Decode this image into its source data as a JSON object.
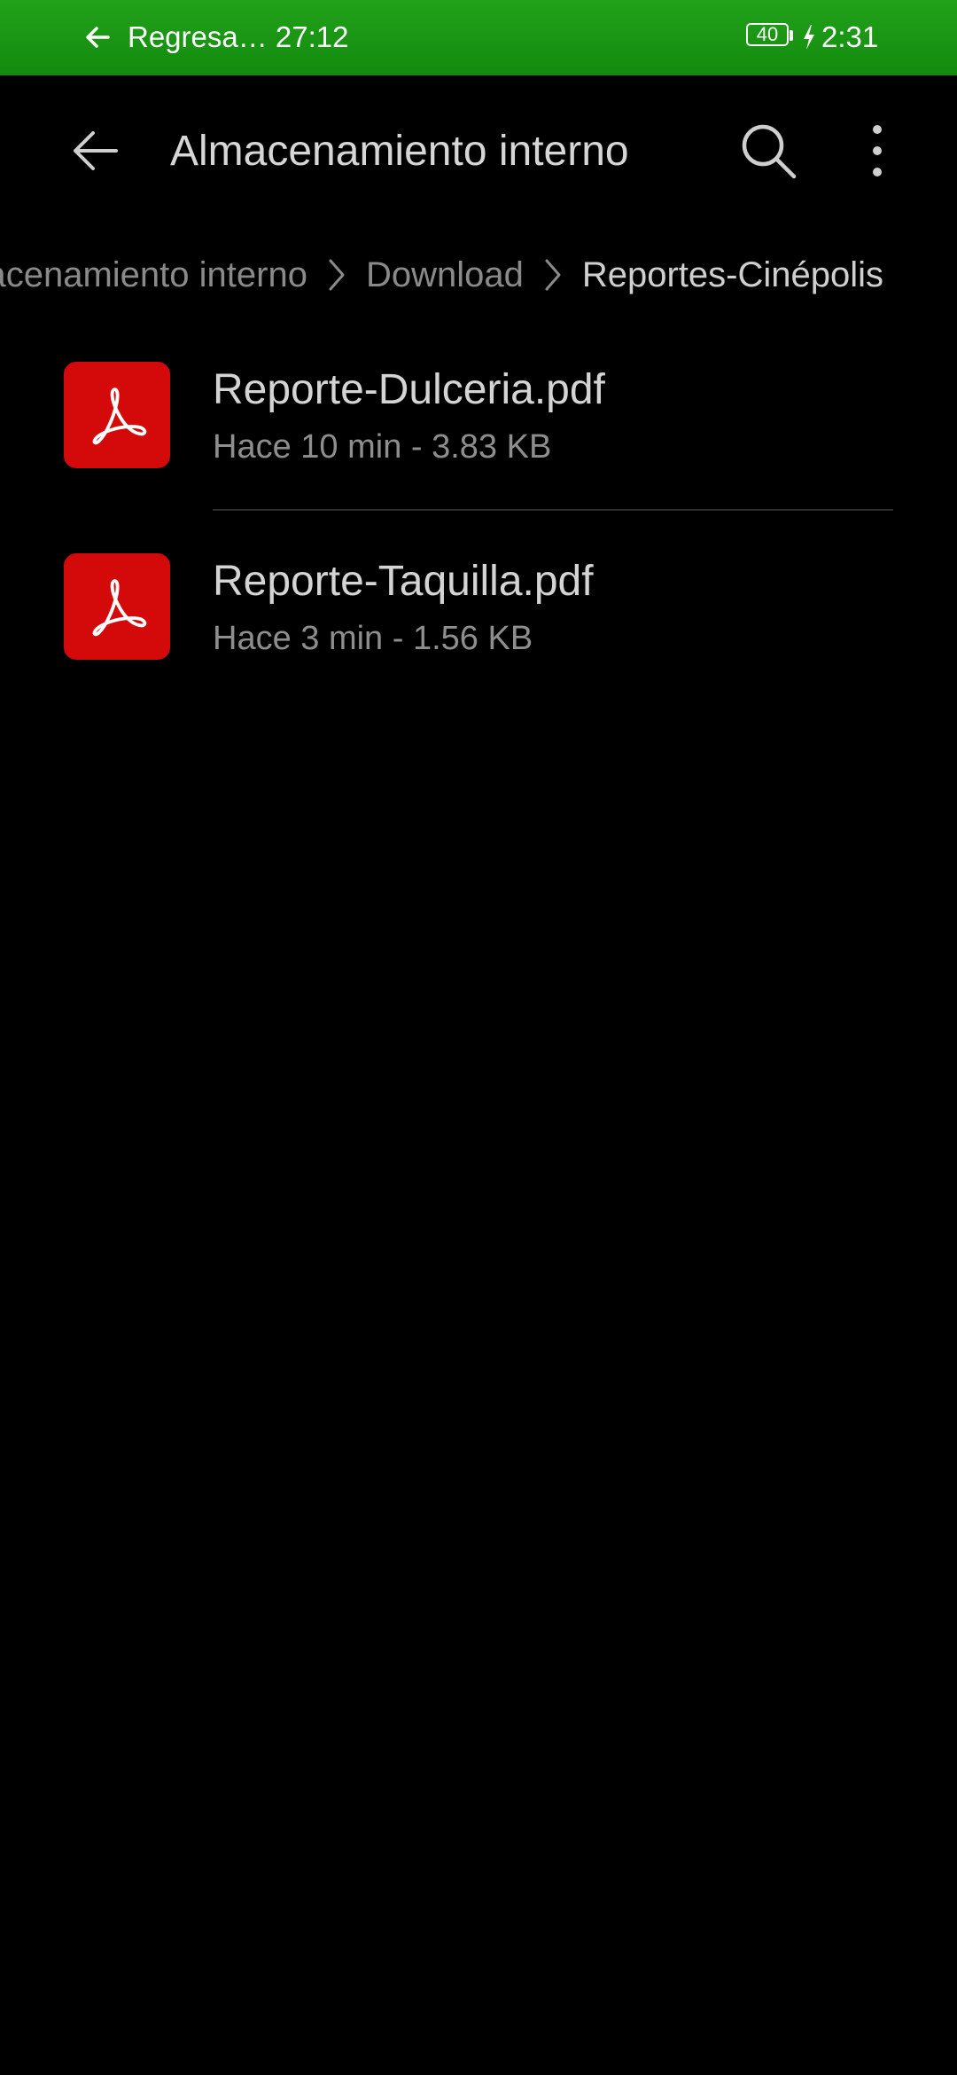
{
  "status_bar": {
    "call_text": "Regresa… 27:12",
    "battery_level": "40",
    "time": "2:31",
    "background_color": "#1a9614"
  },
  "app_bar": {
    "title": "Almacenamiento interno",
    "back_icon": "arrow-left-icon",
    "search_icon": "search-icon",
    "more_icon": "more-vertical-icon"
  },
  "breadcrumb": {
    "items": [
      {
        "label": "Almacenamiento interno"
      },
      {
        "label": "Download"
      },
      {
        "label": "Reportes-Cinépolis"
      }
    ]
  },
  "files": [
    {
      "name": "Reporte-Dulceria.pdf",
      "meta": "Hace 10 min - 3.83 KB",
      "icon": "pdf-icon"
    },
    {
      "name": "Reporte-Taquilla.pdf",
      "meta": "Hace 3 min - 1.56 KB",
      "icon": "pdf-icon"
    }
  ],
  "colors": {
    "pdf_icon_bg": "#d40a0a",
    "background": "#000000"
  }
}
